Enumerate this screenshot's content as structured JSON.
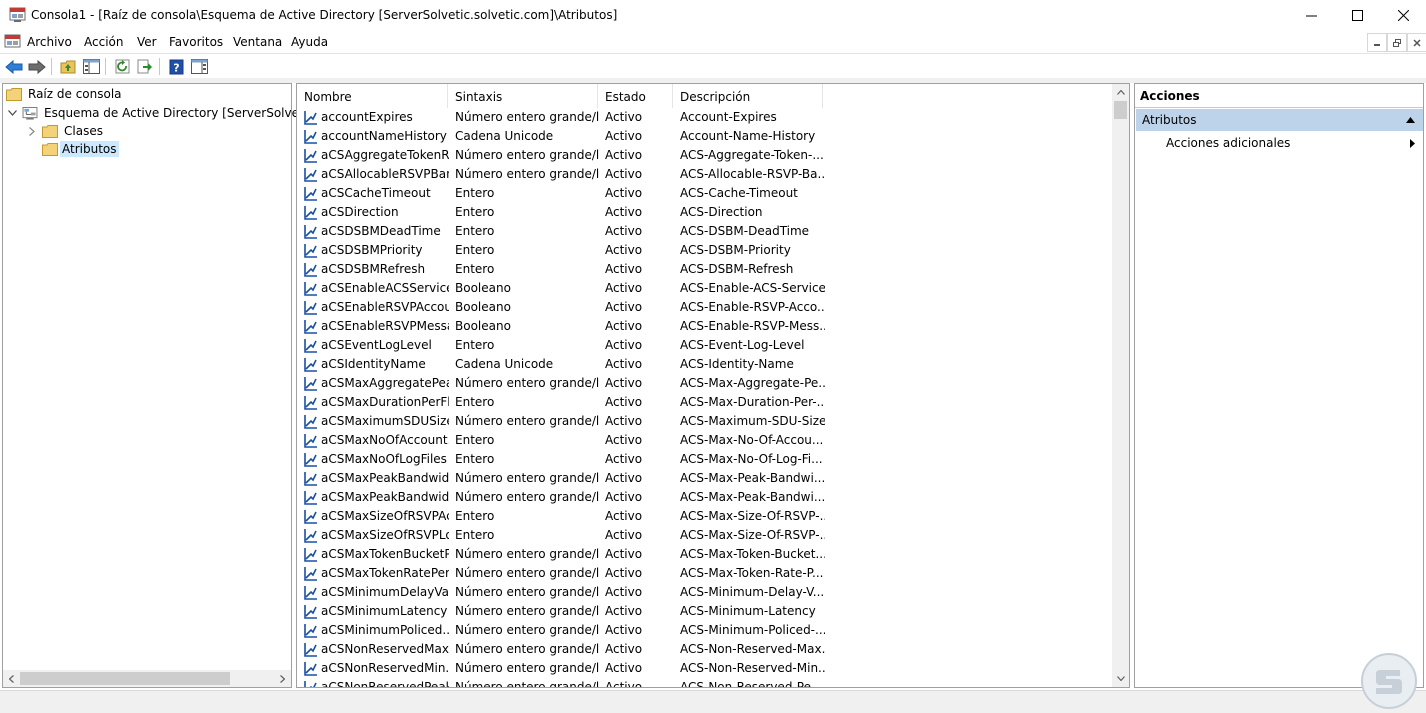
{
  "window": {
    "title": "Consola1 - [Raíz de consola\\Esquema de Active Directory [ServerSolvetic.solvetic.com]\\Atributos]"
  },
  "menu": [
    "Archivo",
    "Acción",
    "Ver",
    "Favoritos",
    "Ventana",
    "Ayuda"
  ],
  "tree": {
    "root": "Raíz de consola",
    "schema": "Esquema de Active Directory [ServerSolvetic.so",
    "classes": "Clases",
    "attributes": "Atributos"
  },
  "columns": [
    "Nombre",
    "Sintaxis",
    "Estado",
    "Descripción"
  ],
  "rows": [
    [
      "accountExpires",
      "Número entero grande/l...",
      "Activo",
      "Account-Expires"
    ],
    [
      "accountNameHistory",
      "Cadena Unicode",
      "Activo",
      "Account-Name-History"
    ],
    [
      "aCSAggregateTokenR...",
      "Número entero grande/l...",
      "Activo",
      "ACS-Aggregate-Token-..."
    ],
    [
      "aCSAllocableRSVPBan...",
      "Número entero grande/l...",
      "Activo",
      "ACS-Allocable-RSVP-Ba..."
    ],
    [
      "aCSCacheTimeout",
      "Entero",
      "Activo",
      "ACS-Cache-Timeout"
    ],
    [
      "aCSDirection",
      "Entero",
      "Activo",
      "ACS-Direction"
    ],
    [
      "aCSDSBMDeadTime",
      "Entero",
      "Activo",
      "ACS-DSBM-DeadTime"
    ],
    [
      "aCSDSBMPriority",
      "Entero",
      "Activo",
      "ACS-DSBM-Priority"
    ],
    [
      "aCSDSBMRefresh",
      "Entero",
      "Activo",
      "ACS-DSBM-Refresh"
    ],
    [
      "aCSEnableACSService",
      "Booleano",
      "Activo",
      "ACS-Enable-ACS-Service"
    ],
    [
      "aCSEnableRSVPAccou...",
      "Booleano",
      "Activo",
      "ACS-Enable-RSVP-Acco..."
    ],
    [
      "aCSEnableRSVPMessa...",
      "Booleano",
      "Activo",
      "ACS-Enable-RSVP-Mess..."
    ],
    [
      "aCSEventLogLevel",
      "Entero",
      "Activo",
      "ACS-Event-Log-Level"
    ],
    [
      "aCSIdentityName",
      "Cadena Unicode",
      "Activo",
      "ACS-Identity-Name"
    ],
    [
      "aCSMaxAggregatePea...",
      "Número entero grande/l...",
      "Activo",
      "ACS-Max-Aggregate-Pe..."
    ],
    [
      "aCSMaxDurationPerFl...",
      "Entero",
      "Activo",
      "ACS-Max-Duration-Per-..."
    ],
    [
      "aCSMaximumSDUSize",
      "Número entero grande/l...",
      "Activo",
      "ACS-Maximum-SDU-Size"
    ],
    [
      "aCSMaxNoOfAccount...",
      "Entero",
      "Activo",
      "ACS-Max-No-Of-Accou..."
    ],
    [
      "aCSMaxNoOfLogFiles",
      "Entero",
      "Activo",
      "ACS-Max-No-Of-Log-Fi..."
    ],
    [
      "aCSMaxPeakBandwidth",
      "Número entero grande/l...",
      "Activo",
      "ACS-Max-Peak-Bandwi..."
    ],
    [
      "aCSMaxPeakBandwidt...",
      "Número entero grande/l...",
      "Activo",
      "ACS-Max-Peak-Bandwi..."
    ],
    [
      "aCSMaxSizeOfRSVPAc...",
      "Entero",
      "Activo",
      "ACS-Max-Size-Of-RSVP-..."
    ],
    [
      "aCSMaxSizeOfRSVPLo...",
      "Entero",
      "Activo",
      "ACS-Max-Size-Of-RSVP-..."
    ],
    [
      "aCSMaxTokenBucketP...",
      "Número entero grande/l...",
      "Activo",
      "ACS-Max-Token-Bucket..."
    ],
    [
      "aCSMaxTokenRatePer...",
      "Número entero grande/l...",
      "Activo",
      "ACS-Max-Token-Rate-P..."
    ],
    [
      "aCSMinimumDelayVa...",
      "Número entero grande/l...",
      "Activo",
      "ACS-Minimum-Delay-V..."
    ],
    [
      "aCSMinimumLatency",
      "Número entero grande/l...",
      "Activo",
      "ACS-Minimum-Latency"
    ],
    [
      "aCSMinimumPoliced...",
      "Número entero grande/l...",
      "Activo",
      "ACS-Minimum-Policed-..."
    ],
    [
      "aCSNonReservedMax...",
      "Número entero grande/l...",
      "Activo",
      "ACS-Non-Reserved-Max..."
    ],
    [
      "aCSNonReservedMin...",
      "Número entero grande/l...",
      "Activo",
      "ACS-Non-Reserved-Min..."
    ],
    [
      "aCSNonReservedPeak...",
      "Número entero grande/l...",
      "Activo",
      "ACS-Non-Reserved-Pe..."
    ]
  ],
  "actions": {
    "title": "Acciones",
    "section": "Atributos",
    "item": "Acciones adicionales"
  },
  "colors": {
    "selection": "#cce8ff",
    "section_header": "#bdd3ea",
    "icon_blue": "#1a4fa3",
    "folder_yellow": "#e8c45a"
  },
  "icons": [
    "mmc-console-icon",
    "minimize-icon",
    "maximize-icon",
    "close-icon",
    "back-arrow-icon",
    "forward-arrow-icon",
    "up-folder-icon",
    "show-tree-icon",
    "refresh-icon",
    "export-icon",
    "help-icon",
    "show-action-pane-icon",
    "folder-icon",
    "schema-icon",
    "attribute-icon",
    "collapse-up-icon",
    "submenu-arrow-icon",
    "watermark-logo"
  ]
}
